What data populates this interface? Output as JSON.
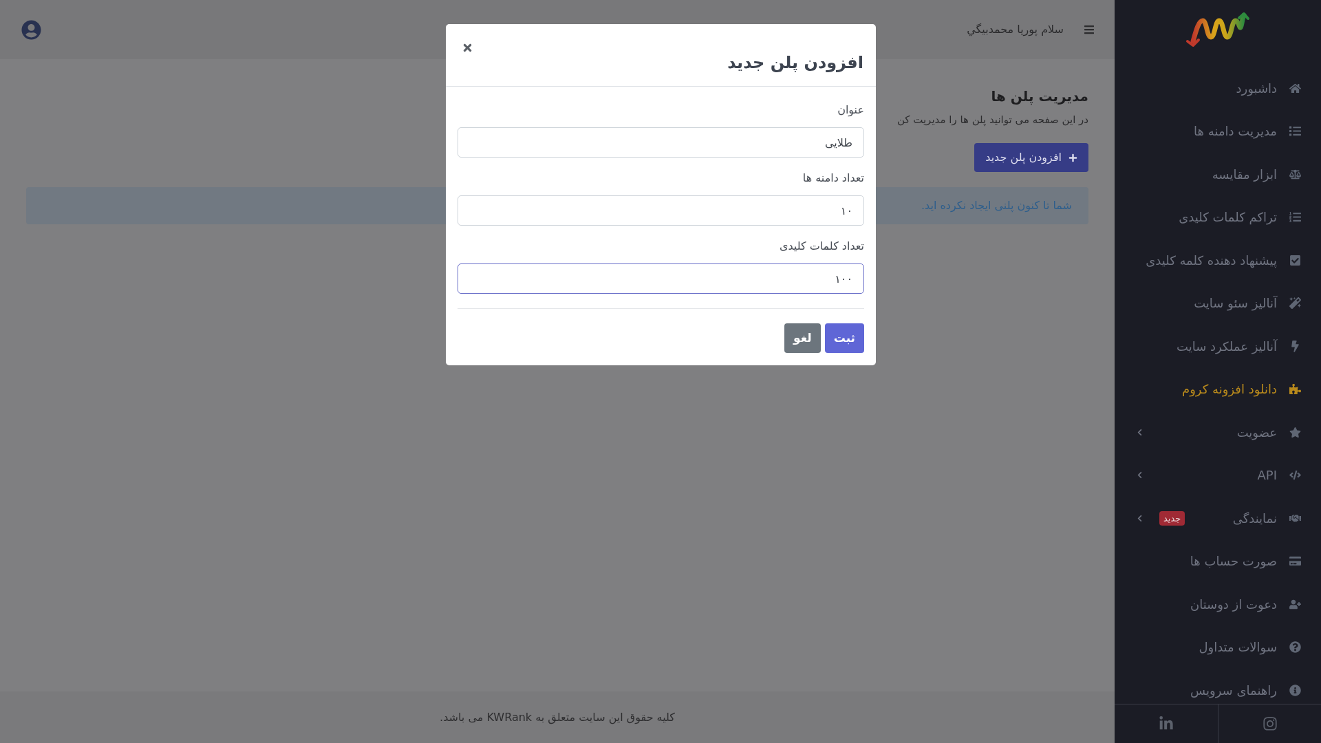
{
  "header": {
    "greeting": "سلام پوریا محمدبیگي"
  },
  "page": {
    "title": "مدیریت پلن ها",
    "description": "در این صفحه می توانید پلن ها را مدیریت کن",
    "add_button": "افزودن پلن جدید",
    "alert": "شما تا کنون پلنی ایجاد نکرده اید."
  },
  "modal": {
    "title": "افزودن پلن جدید",
    "fields": [
      {
        "label": "عنوان",
        "value": "طلایی",
        "focused": false
      },
      {
        "label": "تعداد دامنه ها",
        "value": "۱۰",
        "focused": false
      },
      {
        "label": "تعداد کلمات کلیدی",
        "value": "۱۰۰",
        "focused": true
      }
    ],
    "buttons": [
      {
        "label": "ثبت",
        "kind": "primary"
      },
      {
        "label": "لغو",
        "kind": "secondary"
      }
    ]
  },
  "sidebar": {
    "items": [
      {
        "label": "داشبورد",
        "highlighted": false,
        "has_submenu": false
      },
      {
        "label": "مدیریت دامنه ها",
        "highlighted": false,
        "has_submenu": false
      },
      {
        "label": "ابزار مقایسه",
        "highlighted": false,
        "has_submenu": false
      },
      {
        "label": "تراکم کلمات کلیدی",
        "highlighted": false,
        "has_submenu": false
      },
      {
        "label": "پیشنهاد دهنده کلمه کلیدی",
        "highlighted": false,
        "has_submenu": false
      },
      {
        "label": "آنالیز سئو سایت",
        "highlighted": false,
        "has_submenu": false
      },
      {
        "label": "آنالیز عملکرد سایت",
        "highlighted": false,
        "has_submenu": false
      },
      {
        "label": "دانلود افزونه کروم",
        "highlighted": true,
        "has_submenu": false
      },
      {
        "label": "عضویت",
        "highlighted": false,
        "has_submenu": true
      },
      {
        "label": "API",
        "highlighted": false,
        "has_submenu": true
      },
      {
        "label": "نمایندگی",
        "highlighted": false,
        "has_submenu": true,
        "badge": "جدید"
      },
      {
        "label": "صورت حساب ها",
        "highlighted": false,
        "has_submenu": false
      },
      {
        "label": "دعوت از دوستان",
        "highlighted": false,
        "has_submenu": false
      },
      {
        "label": "سوالات متداول",
        "highlighted": false,
        "has_submenu": false
      },
      {
        "label": "راهنمای سرویس",
        "highlighted": false,
        "has_submenu": false
      }
    ]
  },
  "footer": {
    "text": "کلیه حقوق این سایت متعلق به KWRank می باشد."
  }
}
